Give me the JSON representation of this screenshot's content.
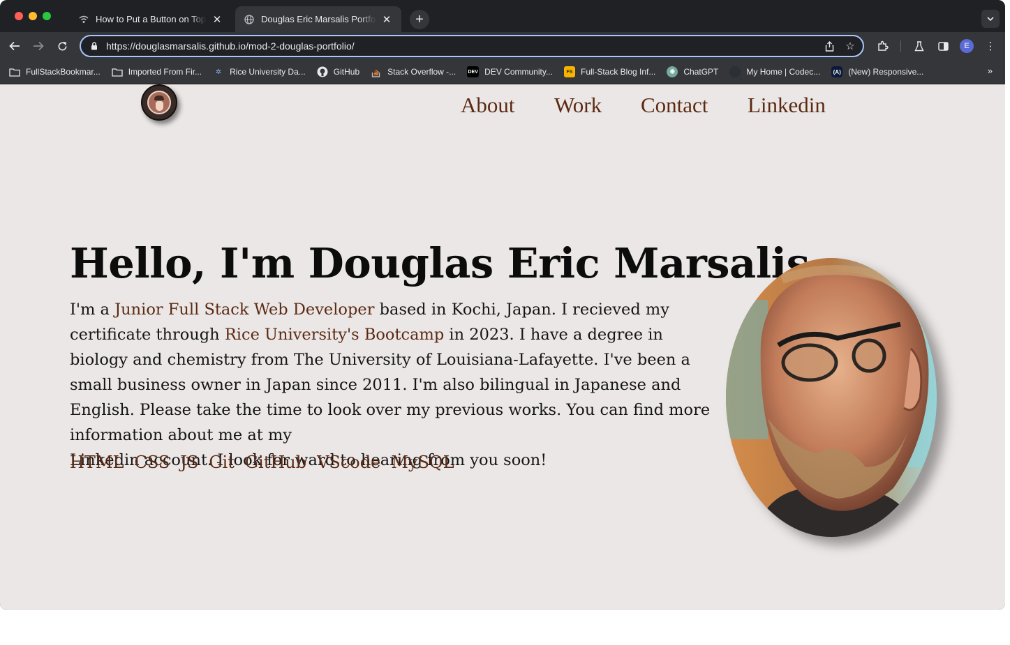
{
  "browser": {
    "tabs": [
      {
        "title": "How to Put a Button on Top of",
        "favicon": "wifi-icon",
        "active": false
      },
      {
        "title": "Douglas Eric Marsalis Portfolio",
        "favicon": "globe-icon",
        "active": true
      }
    ],
    "url": "https://douglasmarsalis.github.io/mod-2-douglas-portfolio/",
    "profile_initial": "E",
    "bookmarks": [
      {
        "label": "FullStackBookmar...",
        "icon": "folder-icon"
      },
      {
        "label": "Imported From Fir...",
        "icon": "folder-icon"
      },
      {
        "label": "Rice University Da...",
        "icon": "rice-icon"
      },
      {
        "label": "GitHub",
        "icon": "github-icon"
      },
      {
        "label": "Stack Overflow -...",
        "icon": "stackoverflow-icon"
      },
      {
        "label": "DEV Community...",
        "icon": "dev-icon"
      },
      {
        "label": "Full-Stack Blog Inf...",
        "icon": "fs-icon"
      },
      {
        "label": "ChatGPT",
        "icon": "chatgpt-icon"
      },
      {
        "label": "My Home | Codec...",
        "icon": "codecademy-icon"
      },
      {
        "label": "(New) Responsive...",
        "icon": "responsive-icon"
      }
    ],
    "more_bookmarks": "»"
  },
  "nav": {
    "about": "About",
    "work": "Work",
    "contact": "Contact",
    "linkedin": "Linkedin"
  },
  "hero": {
    "title": "Hello, I'm Douglas Eric Marsalis",
    "bio_1": "I'm a ",
    "bio_link_1": "Junior Full Stack Web Developer",
    "bio_2": " based in Kochi, Japan. I recieved my certificate through ",
    "bio_link_2": "Rice University's Bootcamp",
    "bio_3": " in 2023. I have a degree in biology and chemistry from The University of Louisiana-Lafayette. I've been a small business owner in Japan since 2011. I'm also bilingual in Japanese and English. Please take the time to look over my previous works. You can find more information about me at my",
    "bio_4": "Linkedin account. I look for ward to hearing from you soon!"
  },
  "skills": [
    "HTML",
    "CSS",
    "JS",
    "Git",
    "GitHub",
    "VScode",
    "MySQL"
  ],
  "colors": {
    "page_bg": "#ebe7e6",
    "accent": "#5a2a12",
    "text": "#151515",
    "chrome_dark": "#202124",
    "chrome_toolbar": "#35363a",
    "omnibox_focus": "#a8c7fa"
  }
}
